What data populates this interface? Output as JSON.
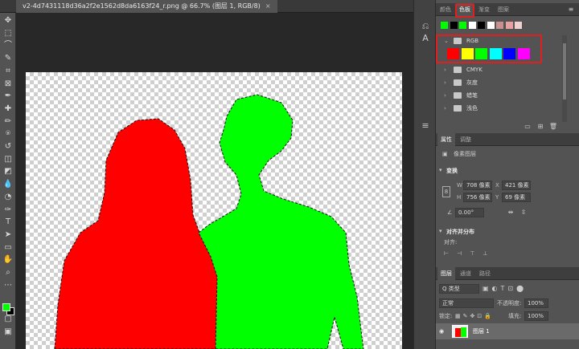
{
  "document": {
    "tab_title": "v2-4d7431118d36a2f2e1562d8da6163f24_r.png @ 66.7% (图层 1, RGB/8)",
    "close_symbol": "×"
  },
  "colors": {
    "red_figure": "#ff0000",
    "green_figure": "#00ff00",
    "foreground": "#00ff00",
    "background": "#000000",
    "highlight_box": "#e02020"
  },
  "tools": [
    "move-icon",
    "marquee-icon",
    "lasso-icon",
    "quick-select-icon",
    "crop-icon",
    "frame-icon",
    "eyedropper-icon",
    "healing-icon",
    "brush-icon",
    "stamp-icon",
    "history-brush-icon",
    "eraser-icon",
    "paint-bucket-icon",
    "blur-icon",
    "dodge-icon",
    "pen-icon",
    "type-icon",
    "path-select-icon",
    "shape-icon",
    "hand-icon",
    "zoom-icon",
    "more-icon"
  ],
  "swatches_panel": {
    "tabs": [
      "颜色",
      "色板",
      "渐变",
      "图案"
    ],
    "quick_colors": [
      "#00ff00",
      "#000000",
      "#00ff00",
      "#ffffff",
      "#000000",
      "#ffffff",
      "#c99090",
      "#e8a0a0",
      "#f0d0d0"
    ],
    "groups": [
      {
        "name": "RGB",
        "expanded": true,
        "colors": [
          "#ff0000",
          "#ffff00",
          "#00ff00",
          "#00ffff",
          "#0000ff",
          "#ff00ff"
        ]
      },
      {
        "name": "CMYK",
        "expanded": false
      },
      {
        "name": "灰度",
        "expanded": false
      },
      {
        "name": "蜡笔",
        "expanded": false
      },
      {
        "name": "浅色",
        "expanded": false
      }
    ]
  },
  "properties_panel": {
    "tabs": [
      "属性",
      "调整"
    ],
    "layer_kind": "像素图层",
    "transform_title": "变换",
    "w_label": "W",
    "w_value": "708 像素",
    "x_label": "X",
    "x_value": "421 像素",
    "h_label": "H",
    "h_value": "756 像素",
    "y_label": "Y",
    "y_value": "69 像素",
    "angle_value": "0.00°",
    "align_title": "对齐并分布",
    "align_label": "对齐:"
  },
  "layers_panel": {
    "tabs": [
      "图层",
      "通道",
      "路径"
    ],
    "filter_kind": "Q 类型",
    "blend_mode": "正常",
    "opacity_label": "不透明度:",
    "opacity_value": "100%",
    "lock_label": "锁定:",
    "fill_label": "填充:",
    "fill_value": "100%",
    "layer_name": "图层 1"
  }
}
